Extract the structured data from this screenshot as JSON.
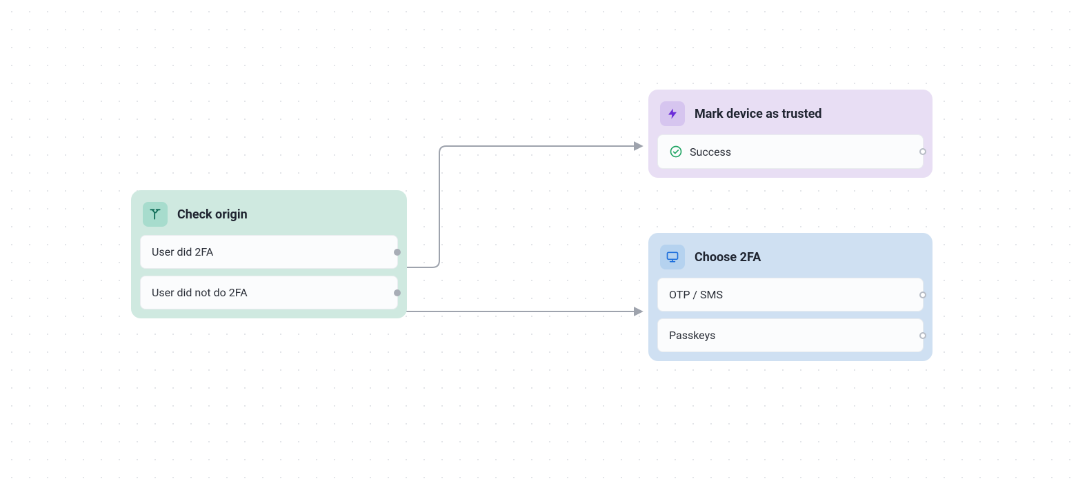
{
  "nodes": {
    "origin": {
      "title": "Check origin",
      "icon": "fork-icon",
      "rows": [
        {
          "label": "User did 2FA"
        },
        {
          "label": "User did not do 2FA"
        }
      ]
    },
    "trusted": {
      "title": "Mark device as trusted",
      "icon": "bolt-icon",
      "rows": [
        {
          "label": "Success",
          "leading_icon": "check-circle-icon"
        }
      ]
    },
    "choose2fa": {
      "title": "Choose 2FA",
      "icon": "monitor-icon",
      "rows": [
        {
          "label": "OTP / SMS"
        },
        {
          "label": "Passkeys"
        }
      ]
    }
  },
  "edges": [
    {
      "from": "origin.rows.0",
      "to": "trusted"
    },
    {
      "from": "origin.rows.1",
      "to": "choose2fa"
    }
  ],
  "colors": {
    "green_bg": "#cfe9e0",
    "purple_bg": "#e8def4",
    "blue_bg": "#cfe0f2",
    "edge": "#9ea3ad",
    "success_green": "#1fa463"
  }
}
